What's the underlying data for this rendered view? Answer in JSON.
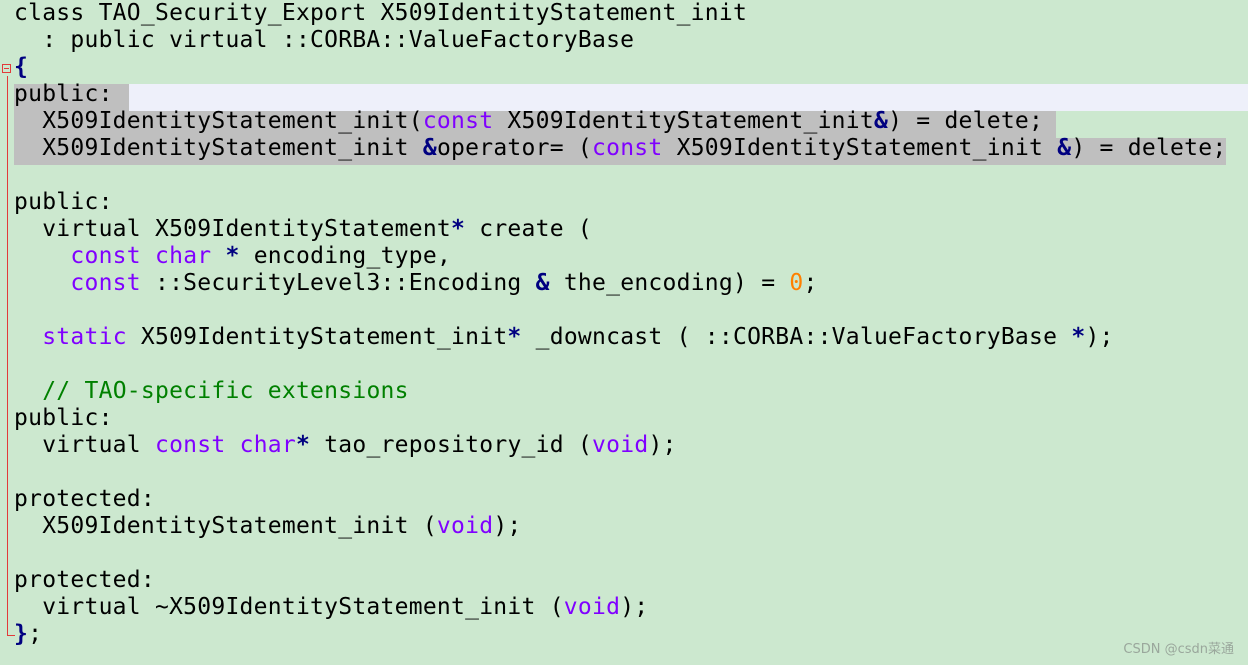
{
  "editor": {
    "background": "#CCE8CF",
    "current_line_color": "#EEF0FA",
    "selection_color": "#BFBFBF",
    "fold_marker_color": "#E23A3A",
    "token_colors": {
      "keyword": "#000000",
      "type": "#8000FF",
      "comment": "#008000",
      "number": "#FF8000",
      "operator": "#000080"
    },
    "lines": {
      "l1_a": "class TAO_Security_Export X509IdentityStatement_init",
      "l2_a": "  : public virtual ::CORBA::ValueFactoryBase",
      "l3_brace": "{",
      "l4_a": "public:",
      "l5_a": "  X509IdentityStatement_init(",
      "l5_b": "const",
      "l5_c": " X509IdentityStatement_init",
      "l5_d": "&",
      "l5_e": ") = delete;",
      "l6_a": "  X509IdentityStatement_init ",
      "l6_b": "&",
      "l6_c": "operator= (",
      "l6_d": "const",
      "l6_e": " X509IdentityStatement_init ",
      "l6_f": "&",
      "l6_g": ") = delete;",
      "l8_a": "public:",
      "l9_a": "  virtual X509IdentityStatement",
      "l9_b": "*",
      "l9_c": " create (",
      "l10_a": "    ",
      "l10_b": "const",
      "l10_c": " ",
      "l10_d": "char",
      "l10_e": " ",
      "l10_f": "*",
      "l10_g": " encoding_type,",
      "l11_a": "    ",
      "l11_b": "const",
      "l11_c": " ::SecurityLevel3::Encoding ",
      "l11_d": "&",
      "l11_e": " the_encoding) = ",
      "l11_f": "0",
      "l11_g": ";",
      "l13_a": "  ",
      "l13_b": "static",
      "l13_c": " X509IdentityStatement_init",
      "l13_d": "*",
      "l13_e": " _downcast ( ::CORBA::ValueFactoryBase ",
      "l13_f": "*",
      "l13_g": ");",
      "l15_a": "  ",
      "l15_b": "// TAO-specific extensions",
      "l16_a": "public:",
      "l17_a": "  virtual ",
      "l17_b": "const",
      "l17_c": " ",
      "l17_d": "char",
      "l17_e": "*",
      "l17_f": " tao_repository_id (",
      "l17_g": "void",
      "l17_h": ");",
      "l19_a": "protected:",
      "l20_a": "  X509IdentityStatement_init (",
      "l20_b": "void",
      "l20_c": ");",
      "l22_a": "protected:",
      "l23_a": "  virtual ~X509IdentityStatement_init (",
      "l23_b": "void",
      "l23_c": ");",
      "l24_a": "}",
      "l24_b": ";"
    }
  },
  "watermark": "CSDN @csdn菜通"
}
